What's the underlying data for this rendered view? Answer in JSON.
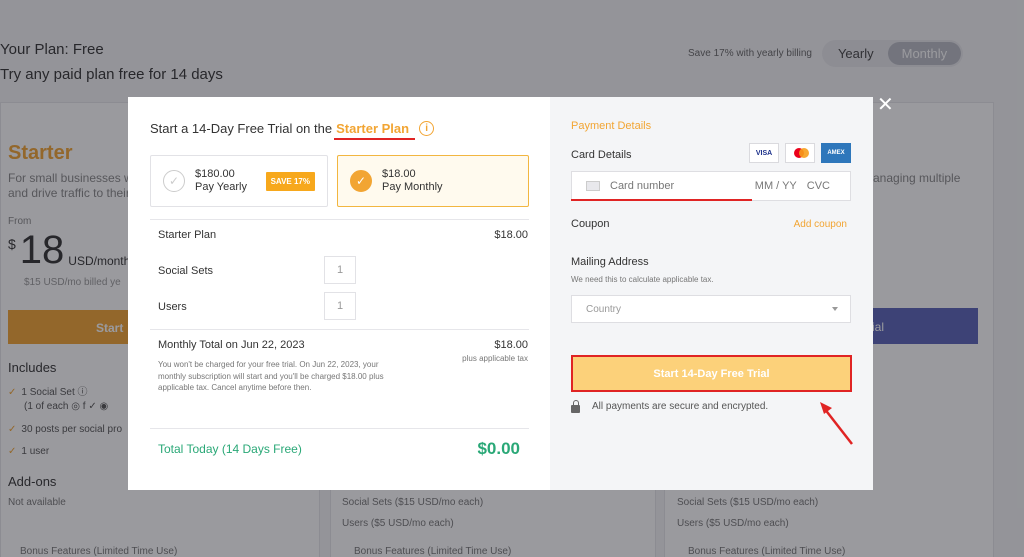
{
  "background": {
    "plan_title": "Your Plan: Free",
    "plan_subtitle": "Try any paid plan free for 14 days",
    "save_note": "Save 17% with yearly billing",
    "toggle": {
      "yearly": "Yearly",
      "monthly": "Monthly"
    },
    "starter": {
      "name": "Starter",
      "desc_line1": "For small businesses wa",
      "desc_line2": "and drive traffic to their",
      "from": "From",
      "currency": "$",
      "price": "18",
      "unit": "USD/month",
      "billed": "$15 USD/mo billed ye",
      "button": "Start"
    },
    "right_desc": "anaging multiple",
    "right_button": "ial",
    "includes_title": "Includes",
    "includes": [
      "1 Social Set",
      "(1 of each",
      "30 posts per social pro",
      "1 user"
    ],
    "addons_title": "Add-ons",
    "not_available": "Not available",
    "col2": [
      "Social Sets ($15 USD/mo each)",
      "Users ($5 USD/mo each)"
    ],
    "col3": [
      "Social Sets ($15 USD/mo each)",
      "Users ($5 USD/mo each)"
    ],
    "bonus": "Bonus Features (Limited Time Use)"
  },
  "modal": {
    "heading_prefix": "Start a 14-Day Free Trial on the",
    "plan_name": "Starter Plan",
    "options": {
      "yearly": {
        "price": "$180.00",
        "label": "Pay Yearly",
        "badge": "SAVE 17%"
      },
      "monthly": {
        "price": "$18.00",
        "label": "Pay Monthly"
      }
    },
    "summary": {
      "plan_label": "Starter Plan",
      "plan_value": "$18.00",
      "social_sets_label": "Social Sets",
      "social_sets_qty": "1",
      "users_label": "Users",
      "users_qty": "1",
      "monthly_total_label": "Monthly Total on Jun 22, 2023",
      "monthly_total_value": "$18.00",
      "plus_tax": "plus applicable tax",
      "fine_print": "You won't be charged for your free trial. On Jun 22, 2023, your monthly subscription will start and you'll be charged $18.00 plus applicable tax. Cancel anytime before then.",
      "total_today_label": "Total Today (14 Days Free)",
      "total_today_value": "$0.00"
    },
    "payment": {
      "title": "Payment Details",
      "card_details_label": "Card Details",
      "card_number_placeholder": "Card number",
      "expiry_placeholder": "MM / YY",
      "cvc_placeholder": "CVC",
      "card_brands": [
        "VISA",
        "mastercard",
        "AMEX"
      ],
      "coupon_label": "Coupon",
      "add_coupon": "Add coupon",
      "mailing_label": "Mailing Address",
      "mailing_note": "We need this to calculate applicable tax.",
      "country_placeholder": "Country",
      "submit": "Start 14-Day Free Trial",
      "secure_note": "All payments are secure and encrypted."
    }
  },
  "colors": {
    "accent": "#f2a533",
    "success": "#2aa877",
    "annotation": "#e02424",
    "purple": "#5963b8"
  }
}
